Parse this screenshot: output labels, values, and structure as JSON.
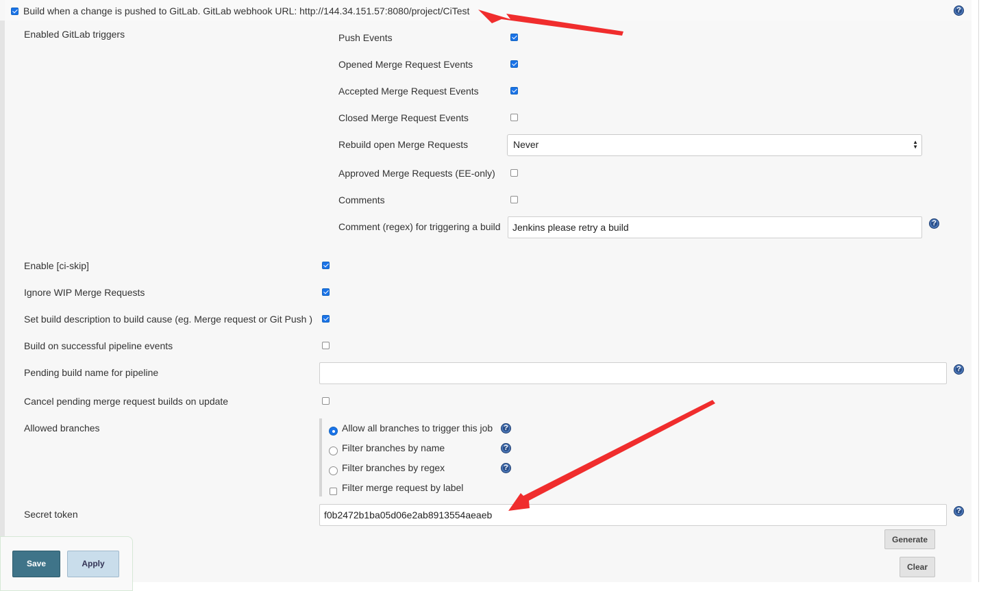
{
  "trigger": {
    "label": "Build when a change is pushed to GitLab. GitLab webhook URL: http://144.34.151.57:8080/project/CiTest",
    "checked": true
  },
  "gitlab_triggers": {
    "section_label": "Enabled GitLab triggers",
    "items": [
      {
        "label": "Push Events",
        "checked": true
      },
      {
        "label": "Opened Merge Request Events",
        "checked": true
      },
      {
        "label": "Accepted Merge Request Events",
        "checked": true
      },
      {
        "label": "Closed Merge Request Events",
        "checked": false
      }
    ],
    "rebuild": {
      "label": "Rebuild open Merge Requests",
      "value": "Never"
    },
    "approved": {
      "label": "Approved Merge Requests (EE-only)",
      "checked": false
    },
    "comments": {
      "label": "Comments",
      "checked": false
    },
    "comment_regex": {
      "label": "Comment (regex) for triggering a build",
      "value": "Jenkins please retry a build"
    }
  },
  "options": {
    "ci_skip": {
      "label": "Enable [ci-skip]",
      "checked": true
    },
    "ignore_wip": {
      "label": "Ignore WIP Merge Requests",
      "checked": true
    },
    "set_description": {
      "label": "Set build description to build cause (eg. Merge request or Git Push )",
      "checked": true
    },
    "pipeline_events": {
      "label": "Build on successful pipeline events",
      "checked": false
    },
    "pending_build_name": {
      "label": "Pending build name for pipeline",
      "value": ""
    },
    "cancel_pending": {
      "label": "Cancel pending merge request builds on update",
      "checked": false
    }
  },
  "allowed_branches": {
    "label": "Allowed branches",
    "options": [
      {
        "label": "Allow all branches to trigger this job",
        "selected": true
      },
      {
        "label": "Filter branches by name",
        "selected": false
      },
      {
        "label": "Filter branches by regex",
        "selected": false
      }
    ],
    "label_filter": {
      "label": "Filter merge request by label",
      "checked": false
    }
  },
  "secret_token": {
    "label": "Secret token",
    "value": "f0b2472b1ba05d06e2ab8913554aeaeb",
    "generate_label": "Generate",
    "clear_label": "Clear"
  },
  "footer": {
    "save_label": "Save",
    "apply_label": "Apply"
  },
  "icons": {
    "help": "help-icon",
    "annotation": "red-arrow"
  },
  "colors": {
    "accent": "#1a73e8",
    "annotation": "#f02d2d",
    "save": "#3f7489",
    "apply": "#c9ddeb"
  }
}
